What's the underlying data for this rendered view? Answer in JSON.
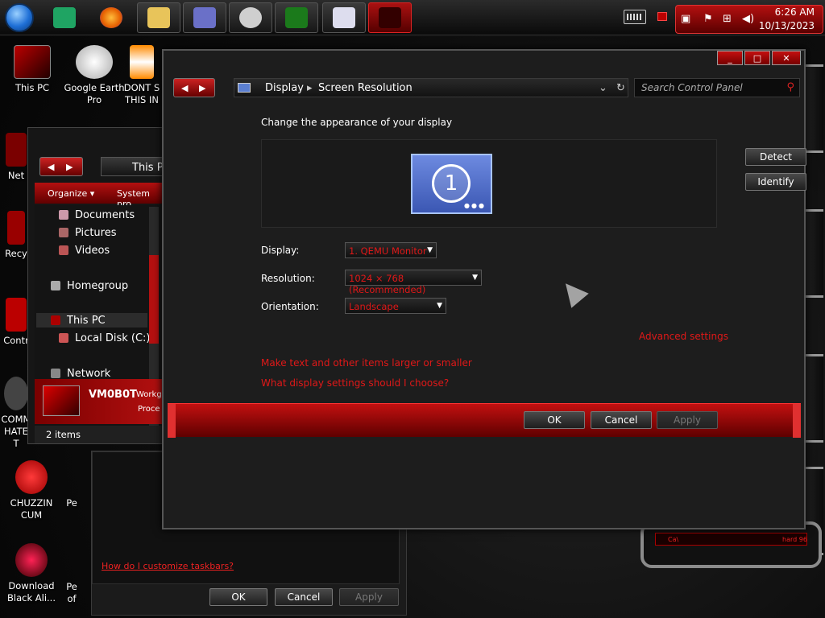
{
  "taskbar": {
    "apps": [
      "File Explorer",
      "Control Panel",
      "Google Earth Pro",
      "Xbox",
      "Task Manager",
      "Alienware"
    ],
    "tray": {
      "time": "6:26 AM",
      "date": "10/13/2023"
    }
  },
  "desktop_icons": [
    {
      "label": "This PC"
    },
    {
      "label": "Google Earth Pro"
    },
    {
      "label": "DONT S THIS IN"
    },
    {
      "label": "Net"
    },
    {
      "label": "Recy"
    },
    {
      "label": "Contr"
    },
    {
      "label": "COMM HATE T"
    },
    {
      "label": "CHUZZIN CUM"
    },
    {
      "label": "Pe"
    },
    {
      "label": "Download Black Ali..."
    },
    {
      "label": "Pe of"
    }
  ],
  "explorer": {
    "address": "This PC",
    "toolbar": {
      "organize": "Organize ▾",
      "system": "System pro"
    },
    "tree": [
      {
        "label": "Documents"
      },
      {
        "label": "Pictures"
      },
      {
        "label": "Videos"
      },
      {
        "label": "Homegroup"
      },
      {
        "label": "This PC"
      },
      {
        "label": "Local Disk (C:)"
      },
      {
        "label": "Network"
      }
    ],
    "details": {
      "name": "VM0B0T",
      "workgroup": "Workg",
      "processor": "Proce"
    },
    "status": "2 items"
  },
  "back_window": {
    "link": "How do I customize taskbars?",
    "ok": "OK",
    "cancel": "Cancel",
    "apply": "Apply"
  },
  "main": {
    "breadcrumb": [
      "Display",
      "Screen Resolution"
    ],
    "search_placeholder": "Search Control Panel",
    "heading": "Change the appearance of your display",
    "monitor_number": "1",
    "detect": "Detect",
    "identify": "Identify",
    "display_label": "Display:",
    "display_value": "1. QEMU Monitor",
    "resolution_label": "Resolution:",
    "resolution_value": "1024 × 768 (Recommended)",
    "orientation_label": "Orientation:",
    "orientation_value": "Landscape",
    "advanced": "Advanced settings",
    "link1": "Make text and other items larger or smaller",
    "link2": "What display settings should I choose?",
    "ok": "OK",
    "cancel": "Cancel",
    "apply": "Apply"
  },
  "colors": {
    "accent": "#c21010",
    "link": "#e01818"
  }
}
